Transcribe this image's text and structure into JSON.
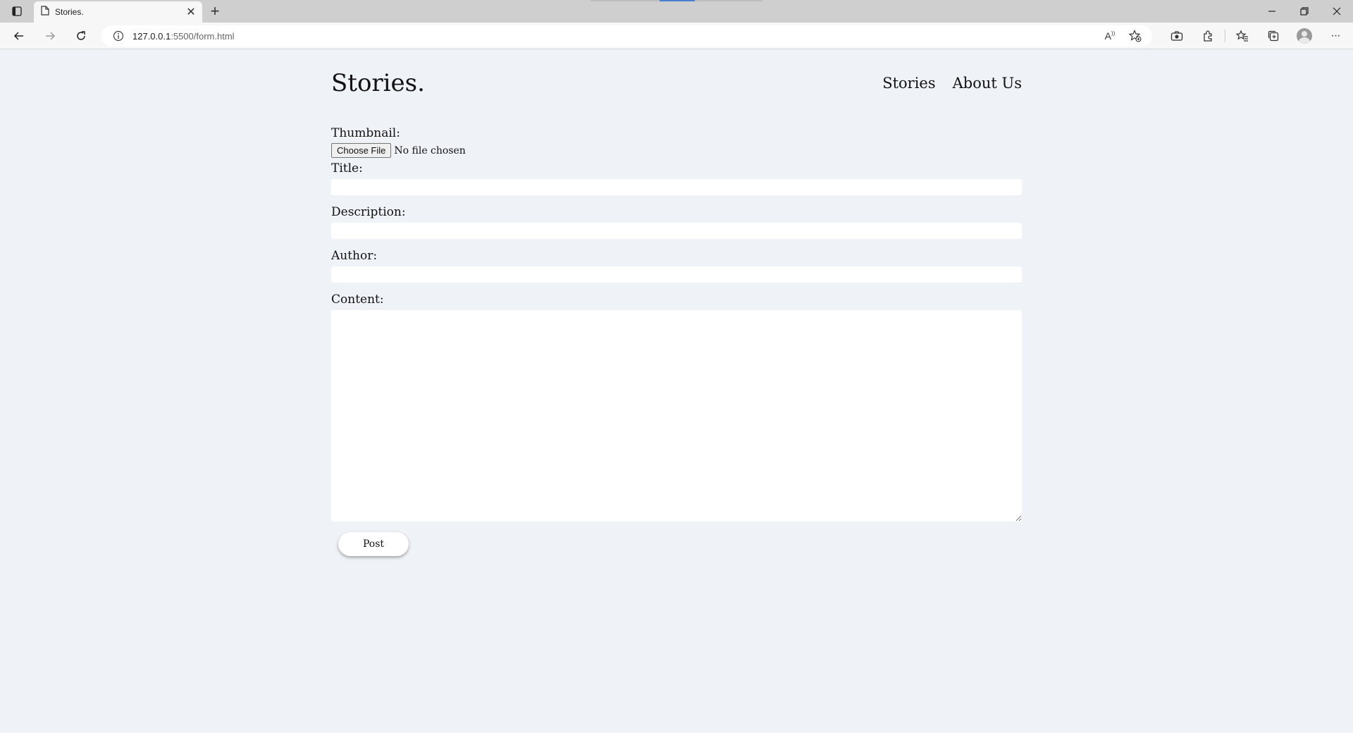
{
  "browser": {
    "tab_title": "Stories.",
    "url_host": "127.0.0.1",
    "url_rest": ":5500/form.html",
    "new_tab_symbol": "+",
    "close_symbol": "✕",
    "icons": [
      "sidebar-icon",
      "page-icon",
      "back-arrow-icon",
      "forward-arrow-icon",
      "reload-icon",
      "info-icon",
      "read-aloud-icon",
      "add-favorite-icon",
      "screenshot-icon",
      "extensions-icon",
      "favorites-icon",
      "collections-icon",
      "profile-icon",
      "more-icon",
      "minimize-icon",
      "restore-icon",
      "close-window-icon"
    ],
    "read_aloud_glyph": "A",
    "more_glyph": "···"
  },
  "site": {
    "brand": "Stories.",
    "nav": [
      "Stories",
      "About Us"
    ]
  },
  "form": {
    "thumbnail_label": "Thumbnail:",
    "file_button": "Choose File",
    "file_status": "No file chosen",
    "title_label": "Title:",
    "title_value": "",
    "description_label": "Description:",
    "description_value": "",
    "author_label": "Author:",
    "author_value": "",
    "content_label": "Content:",
    "content_value": "",
    "submit_label": "Post"
  }
}
